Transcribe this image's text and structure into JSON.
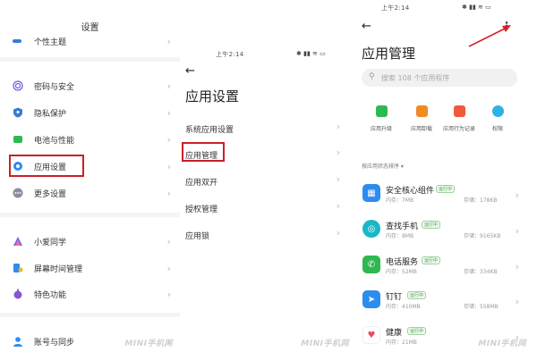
{
  "panel1": {
    "title": "设置",
    "items": [
      {
        "label": "个性主题",
        "icon": "theme-icon",
        "color": "#3a7bd5"
      },
      {
        "label": "密码与安全",
        "icon": "fingerprint-icon",
        "color": "#6b5be0"
      },
      {
        "label": "隐私保护",
        "icon": "privacy-shield-icon",
        "color": "#3a7bd5"
      },
      {
        "label": "电池与性能",
        "icon": "battery-icon",
        "color": "#2fb84f"
      },
      {
        "label": "应用设置",
        "icon": "gear-icon",
        "color": "#2d8cf0"
      },
      {
        "label": "更多设置",
        "icon": "more-dots-icon",
        "color": "#8a8fa0"
      },
      {
        "label": "小爱同学",
        "icon": "xiaoai-icon",
        "color": "#5a6cf0"
      },
      {
        "label": "屏幕时间管理",
        "icon": "screen-time-icon",
        "color": "#2d8cf0"
      },
      {
        "label": "特色功能",
        "icon": "feature-icon",
        "color": "#8b54d6"
      },
      {
        "label": "账号与同步",
        "icon": "account-icon",
        "color": "#2d8cf0"
      }
    ],
    "watermark": "MINI手机网"
  },
  "panel2": {
    "status_time": "上午2:14",
    "title": "应用设置",
    "items": [
      {
        "label": "系统应用设置"
      },
      {
        "label": "应用管理"
      },
      {
        "label": "应用双开"
      },
      {
        "label": "授权管理"
      },
      {
        "label": "应用锁"
      }
    ],
    "watermark": "MINI手机网"
  },
  "panel3": {
    "status_time": "上午2:14",
    "title": "应用管理",
    "search_placeholder": "搜索 108 个应用程序",
    "tools": [
      {
        "label": "应用升级",
        "icon": "upgrade-icon",
        "color": "#2fb84f"
      },
      {
        "label": "应用卸载",
        "icon": "uninstall-icon",
        "color": "#f08a24"
      },
      {
        "label": "应用行为记录",
        "icon": "behavior-log-icon",
        "color": "#f05a3a"
      },
      {
        "label": "权限",
        "icon": "permission-icon",
        "color": "#2fb0e8"
      }
    ],
    "sort_label": "按应用状态排序",
    "apps": [
      {
        "name": "安全核心组件",
        "badge": "运行中",
        "mem": "内存：7MB",
        "storage": "存储：178KB",
        "icon": "security-core-icon",
        "color": "#2d8cf0",
        "glyph": "▦"
      },
      {
        "name": "查找手机",
        "badge": "运行中",
        "mem": "内存：8MB",
        "storage": "存储：9165KB",
        "icon": "find-phone-icon",
        "color": "#18b8c8",
        "glyph": "◎"
      },
      {
        "name": "电话服务",
        "badge": "运行中",
        "mem": "内存：52MB",
        "storage": "存储：334KB",
        "icon": "phone-service-icon",
        "color": "#2fb84f",
        "glyph": "✆"
      },
      {
        "name": "钉钉",
        "badge": "运行中",
        "mem": "内存：410MB",
        "storage": "存储：558MB",
        "icon": "dingtalk-icon",
        "color": "#2d8cf0",
        "glyph": "➤"
      },
      {
        "name": "健康",
        "badge": "运行中",
        "mem": "内存：21MB",
        "storage": "",
        "icon": "health-icon",
        "color": "#f04a5a",
        "glyph": "♥"
      }
    ],
    "watermark": "MINI手机网"
  },
  "colors": {
    "highlight": "#c8202a",
    "accent": "#2d8cf0"
  }
}
